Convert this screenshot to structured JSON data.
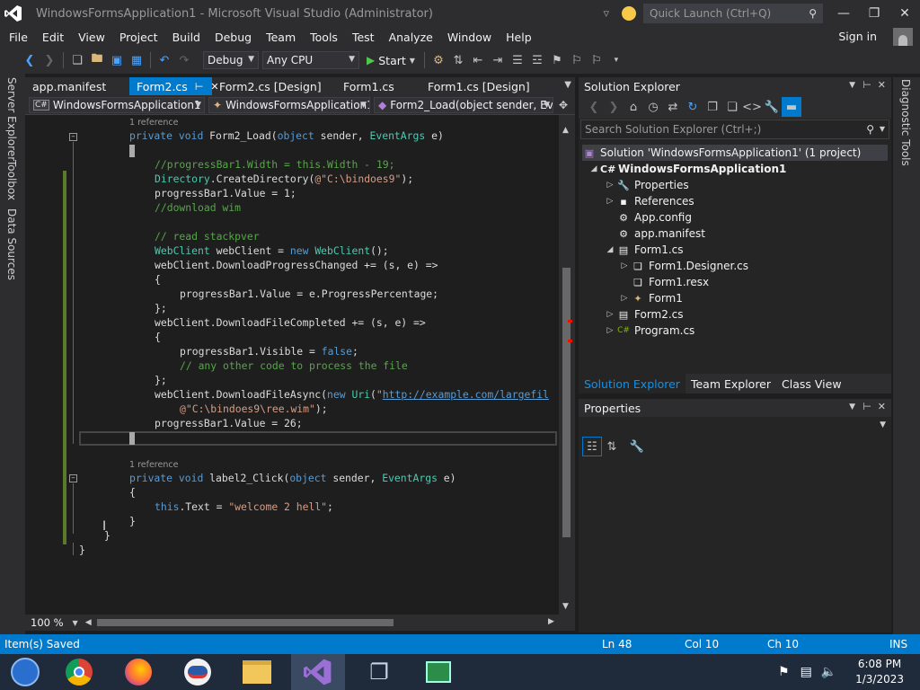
{
  "window": {
    "title": "WindowsFormsApplication1 - Microsoft Visual Studio (Administrator)",
    "quick_launch_placeholder": "Quick Launch (Ctrl+Q)"
  },
  "menu": {
    "items": [
      "File",
      "Edit",
      "View",
      "Project",
      "Build",
      "Debug",
      "Team",
      "Tools",
      "Test",
      "Analyze",
      "Window",
      "Help"
    ],
    "signin": "Sign in"
  },
  "toolbar": {
    "config": "Debug",
    "platform": "Any CPU",
    "start": "Start"
  },
  "side_tabs": [
    "Server Explorer",
    "Toolbox",
    "Data Sources"
  ],
  "right_tabs": [
    "Diagnostic Tools"
  ],
  "doc_tabs": [
    {
      "label": "app.manifest",
      "active": false
    },
    {
      "label": "Form2.cs",
      "active": true
    },
    {
      "label": "Form2.cs [Design]",
      "active": false
    },
    {
      "label": "Form1.cs",
      "active": false
    },
    {
      "label": "Form1.cs [Design]",
      "active": false
    }
  ],
  "navbar": {
    "project": "WindowsFormsApplication1",
    "type": "WindowsFormsApplication1.Fo",
    "member": "Form2_Load(object sender, Eve"
  },
  "editor": {
    "ref1": "1 reference",
    "ref2": "1 reference",
    "zoom": "100 %"
  },
  "solution_explorer": {
    "title": "Solution Explorer",
    "search_placeholder": "Search Solution Explorer (Ctrl+;)",
    "nodes": [
      {
        "label": "Solution 'WindowsFormsApplication1' (1 project)"
      },
      {
        "label": "WindowsFormsApplication1"
      },
      {
        "label": "Properties"
      },
      {
        "label": "References"
      },
      {
        "label": "App.config"
      },
      {
        "label": "app.manifest"
      },
      {
        "label": "Form1.cs"
      },
      {
        "label": "Form1.Designer.cs"
      },
      {
        "label": "Form1.resx"
      },
      {
        "label": "Form1"
      },
      {
        "label": "Form2.cs"
      },
      {
        "label": "Program.cs"
      }
    ],
    "tabs": [
      "Solution Explorer",
      "Team Explorer",
      "Class View"
    ]
  },
  "properties": {
    "title": "Properties"
  },
  "status": {
    "message": "Item(s) Saved",
    "ln": "Ln 48",
    "col": "Col 10",
    "ch": "Ch 10",
    "mode": "INS"
  },
  "taskbar": {
    "time": "6:08 PM",
    "date": "1/3/2023"
  },
  "colors": {
    "accent": "#007acc",
    "chrome": "#2d2d30",
    "editor_bg": "#1e1e1e",
    "keyword": "#569cd6",
    "type": "#4ec9b0",
    "string": "#d69d85",
    "comment": "#57a64a"
  }
}
